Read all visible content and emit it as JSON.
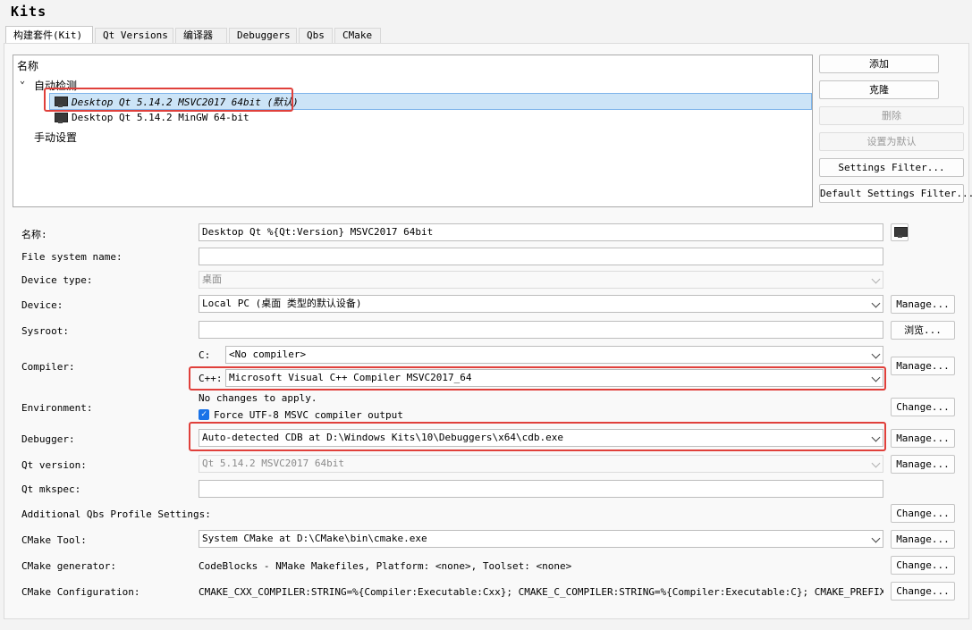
{
  "window": {
    "title": "Kits"
  },
  "tabs": [
    {
      "label": "构建套件(Kit)",
      "active": true
    },
    {
      "label": "Qt Versions"
    },
    {
      "label": "编译器"
    },
    {
      "label": "Debuggers"
    },
    {
      "label": "Qbs"
    },
    {
      "label": "CMake"
    }
  ],
  "tree": {
    "header": "名称",
    "group_auto": "自动检测",
    "kit1": "Desktop Qt 5.14.2 MSVC2017 64bit (默认)",
    "kit2": "Desktop Qt 5.14.2 MinGW 64-bit",
    "group_manual": "手动设置"
  },
  "side_buttons": {
    "add": "添加",
    "clone": "克隆",
    "remove": "删除",
    "make_default": "设置为默认",
    "settings_filter": "Settings Filter...",
    "default_settings_filter": "Default Settings Filter..."
  },
  "form": {
    "name_label": "名称:",
    "name_value": "Desktop Qt %{Qt:Version} MSVC2017 64bit",
    "fsname_label": "File system name:",
    "fsname_value": "",
    "device_type_label": "Device type:",
    "device_type_value": "桌面",
    "device_label": "Device:",
    "device_value": "Local PC (桌面 类型的默认设备)",
    "device_manage": "Manage...",
    "sysroot_label": "Sysroot:",
    "sysroot_value": "",
    "sysroot_browse": "浏览...",
    "compiler_label": "Compiler:",
    "compiler_c_label": "C:",
    "compiler_c_value": "<No compiler>",
    "compiler_cpp_label": "C++:",
    "compiler_cpp_value": "Microsoft Visual C++ Compiler MSVC2017_64",
    "compiler_manage": "Manage...",
    "environment_label": "Environment:",
    "environment_text": "No changes to apply.",
    "environment_checkbox": "Force UTF-8 MSVC compiler output",
    "environment_change": "Change...",
    "debugger_label": "Debugger:",
    "debugger_value": "Auto-detected CDB at D:\\Windows Kits\\10\\Debuggers\\x64\\cdb.exe",
    "debugger_manage": "Manage...",
    "qtversion_label": "Qt version:",
    "qtversion_value": "Qt 5.14.2 MSVC2017 64bit",
    "qtversion_manage": "Manage...",
    "mkspec_label": "Qt mkspec:",
    "mkspec_value": "",
    "qbs_label": "Additional Qbs Profile Settings:",
    "qbs_change": "Change...",
    "cmake_tool_label": "CMake Tool:",
    "cmake_tool_value": "System CMake at D:\\CMake\\bin\\cmake.exe",
    "cmake_tool_manage": "Manage...",
    "cmake_gen_label": "CMake generator:",
    "cmake_gen_value": "CodeBlocks - NMake Makefiles, Platform: <none>, Toolset: <none>",
    "cmake_gen_change": "Change...",
    "cmake_conf_label": "CMake Configuration:",
    "cmake_conf_value": "CMAKE_CXX_COMPILER:STRING=%{Compiler:Executable:Cxx}; CMAKE_C_COMPILER:STRING=%{Compiler:Executable:C}; CMAKE_PREFIX_PATH:STR…",
    "cmake_conf_change": "Change..."
  },
  "colors": {
    "highlight": "#e0403b",
    "selection": "#cce4f7",
    "checkbox": "#1a73e8"
  }
}
